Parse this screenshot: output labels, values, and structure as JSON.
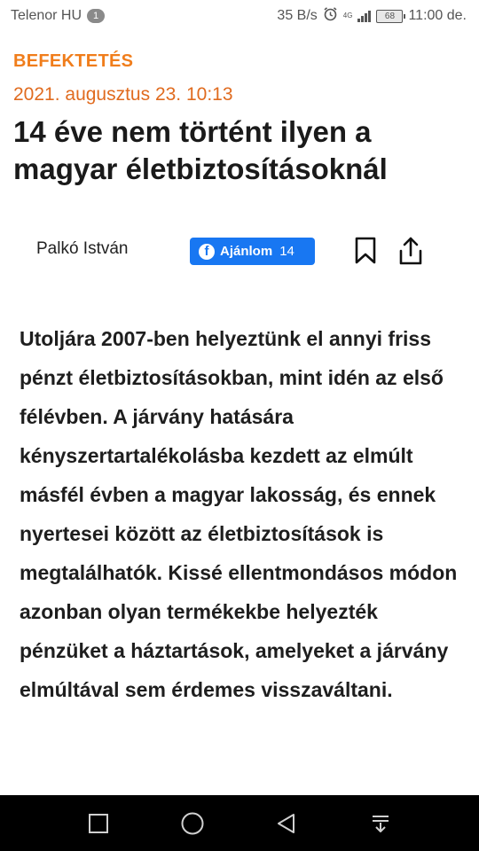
{
  "status_bar": {
    "carrier": "Telenor HU",
    "sim_badge": "1",
    "net_speed": "35 B/s",
    "network_type": "4G",
    "battery": "68",
    "time": "11:00 de.",
    "icons": [
      "alarm-icon",
      "signal-icon",
      "battery-icon"
    ]
  },
  "article": {
    "category": "BEFEKTETÉS",
    "date": "2021. augusztus 23. 10:13",
    "title": "14 éve nem történt ilyen a magyar életbiztosításoknál",
    "author": "Palkó István",
    "fb_button": {
      "label": "Ajánlom",
      "count": "14"
    },
    "lead": "Utoljára 2007-ben helyeztünk el annyi friss pénzt életbiztosításokban, mint idén az első félévben. A járvány hatására kényszertartalékolásba kezdett az elmúlt másfél évben a magyar lakosság, és ennek nyertesei között az életbiztosítások is megtalálhatók. Kissé ellentmondásos módon azonban olyan termékekbe helyezték pénzüket a háztartások, amelyeket a járvány elmúltával sem érdemes visszaváltani."
  },
  "colors": {
    "category": "#f07d1b",
    "date": "#e06b1f",
    "facebook": "#1877f2",
    "nav_bar": "#000000"
  },
  "nav_bar": {
    "icons": [
      "square-icon",
      "circle-icon",
      "back-triangle-icon",
      "notification-shade-icon"
    ]
  }
}
